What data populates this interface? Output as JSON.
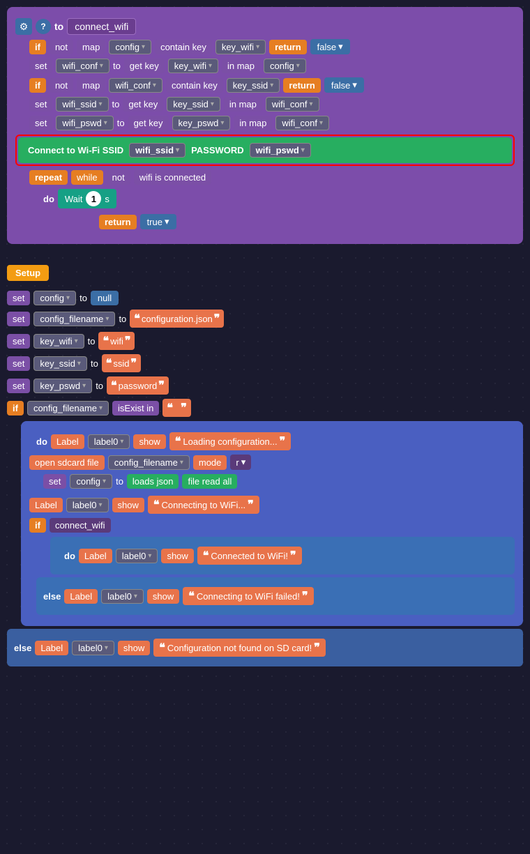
{
  "top_function": {
    "gear_icon": "⚙",
    "help_icon": "?",
    "to_label": "to",
    "function_name": "connect_wifi",
    "blocks": [
      {
        "type": "if_row",
        "if": "if",
        "not": "not",
        "map": "map",
        "var1": "config",
        "contain": "contain key",
        "var2": "key_wifi",
        "return": "return",
        "value": "false"
      },
      {
        "type": "set_row",
        "set": "set",
        "var1": "wifi_conf",
        "to": "to",
        "get": "get key",
        "var2": "key_wifi",
        "in": "in map",
        "var3": "config"
      },
      {
        "type": "if_row2",
        "if": "if",
        "not": "not",
        "map": "map",
        "var1": "wifi_conf",
        "contain": "contain key",
        "var2": "key_ssid",
        "return": "return",
        "value": "false"
      },
      {
        "type": "set_row2",
        "set": "set",
        "var1": "wifi_ssid",
        "to": "to",
        "get": "get key",
        "var2": "key_ssid",
        "in": "in map",
        "var3": "wifi_conf"
      },
      {
        "type": "set_row3",
        "set": "set",
        "var1": "wifi_pswd",
        "to": "to",
        "get": "get key",
        "var2": "key_pswd",
        "in": "in map",
        "var3": "wifi_conf"
      },
      {
        "type": "wifi_connect",
        "label": "Connect to Wi-Fi SSID",
        "ssid_var": "wifi_ssid",
        "password_label": "PASSWORD",
        "pswd_var": "wifi_pswd"
      },
      {
        "type": "repeat_row",
        "repeat": "repeat",
        "while": "while",
        "not": "not",
        "connected": "wifi is connected"
      },
      {
        "type": "do_row",
        "do": "do",
        "wait": "Wait",
        "number": "1",
        "s": "s"
      }
    ],
    "return_true": "return",
    "true_val": "true"
  },
  "bottom_function": {
    "setup_label": "Setup",
    "rows": [
      {
        "set": "set",
        "var": "config",
        "to": "to",
        "value_type": "null",
        "value": "null"
      },
      {
        "set": "set",
        "var": "config_filename",
        "to": "to",
        "value_type": "string",
        "value": "configuration.json"
      },
      {
        "set": "set",
        "var": "key_wifi",
        "to": "to",
        "value_type": "string",
        "value": "wifi"
      },
      {
        "set": "set",
        "var": "key_ssid",
        "to": "to",
        "value_type": "string",
        "value": "ssid"
      },
      {
        "set": "set",
        "var": "key_pswd",
        "to": "to",
        "value_type": "string",
        "value": "password"
      }
    ],
    "if_row": {
      "if": "if",
      "var": "config_filename",
      "is_exist": "isExist in",
      "in_str": ""
    },
    "do_label": "do",
    "do_label2": "Label",
    "label0": "label0",
    "show": "show",
    "loading_msg": "Loading configuration...",
    "open_sdcard": "open sdcard file",
    "config_filename_var": "config_filename",
    "mode_label": "mode",
    "mode_r": "r",
    "set_config": "set",
    "config_var": "config",
    "to2": "to",
    "loads_json": "loads json",
    "file_read": "file read all",
    "connecting_label": "Label",
    "label0_2": "label0",
    "show2": "show",
    "connecting_msg": "Connecting to WiFi...",
    "if2": "if",
    "connect_wifi_call": "connect_wifi",
    "do2": "do",
    "connected_label": "Label",
    "label0_3": "label0",
    "show3": "show",
    "connected_msg": "Connected to WiFi!",
    "else_label": "else",
    "failed_label": "Label",
    "label0_4": "label0",
    "show4": "show",
    "failed_msg": "Connecting to WiFi failed!",
    "else2_label": "else",
    "not_found_label": "Label",
    "label0_5": "label0",
    "show5": "show",
    "not_found_msg": "Configuration not found on SD card!"
  }
}
